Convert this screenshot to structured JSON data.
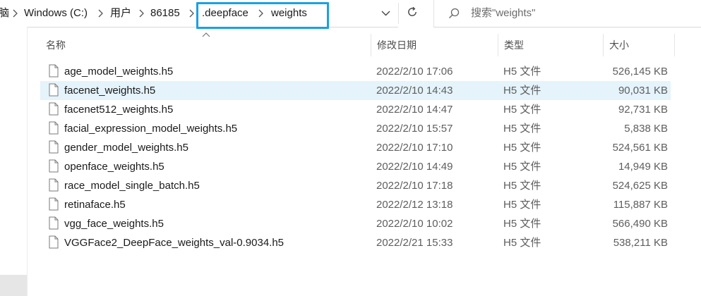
{
  "address_bar": {
    "breadcrumbs": [
      "脑",
      "Windows (C:)",
      "用户",
      "86185",
      ".deepface",
      "weights"
    ]
  },
  "search": {
    "placeholder": "搜索\"weights\""
  },
  "columns": {
    "name": "名称",
    "modified": "修改日期",
    "type": "类型",
    "size": "大小"
  },
  "files": [
    {
      "name": "age_model_weights.h5",
      "modified": "2022/2/10 17:06",
      "type": "H5 文件",
      "size": "526,145 KB",
      "selected": false
    },
    {
      "name": "facenet_weights.h5",
      "modified": "2022/2/10 14:43",
      "type": "H5 文件",
      "size": "90,031 KB",
      "selected": true
    },
    {
      "name": "facenet512_weights.h5",
      "modified": "2022/2/10 14:47",
      "type": "H5 文件",
      "size": "92,731 KB",
      "selected": false
    },
    {
      "name": "facial_expression_model_weights.h5",
      "modified": "2022/2/10 15:57",
      "type": "H5 文件",
      "size": "5,838 KB",
      "selected": false
    },
    {
      "name": "gender_model_weights.h5",
      "modified": "2022/2/10 17:10",
      "type": "H5 文件",
      "size": "524,561 KB",
      "selected": false
    },
    {
      "name": "openface_weights.h5",
      "modified": "2022/2/10 14:49",
      "type": "H5 文件",
      "size": "14,949 KB",
      "selected": false
    },
    {
      "name": "race_model_single_batch.h5",
      "modified": "2022/2/10 17:18",
      "type": "H5 文件",
      "size": "524,625 KB",
      "selected": false
    },
    {
      "name": "retinaface.h5",
      "modified": "2022/2/12 13:18",
      "type": "H5 文件",
      "size": "115,887 KB",
      "selected": false
    },
    {
      "name": "vgg_face_weights.h5",
      "modified": "2022/2/10 10:02",
      "type": "H5 文件",
      "size": "566,490 KB",
      "selected": false
    },
    {
      "name": "VGGFace2_DeepFace_weights_val-0.9034.h5",
      "modified": "2022/2/21 15:33",
      "type": "H5 文件",
      "size": "538,211 KB",
      "selected": false
    }
  ],
  "colors": {
    "highlight_box": "#1aa0e6",
    "selected_row": "#e5f3fb"
  },
  "icons": {
    "file": "file-icon",
    "search": "search-icon",
    "refresh": "refresh-icon",
    "dropdown": "chevron-down-icon",
    "separator": "chevron-right-icon"
  }
}
